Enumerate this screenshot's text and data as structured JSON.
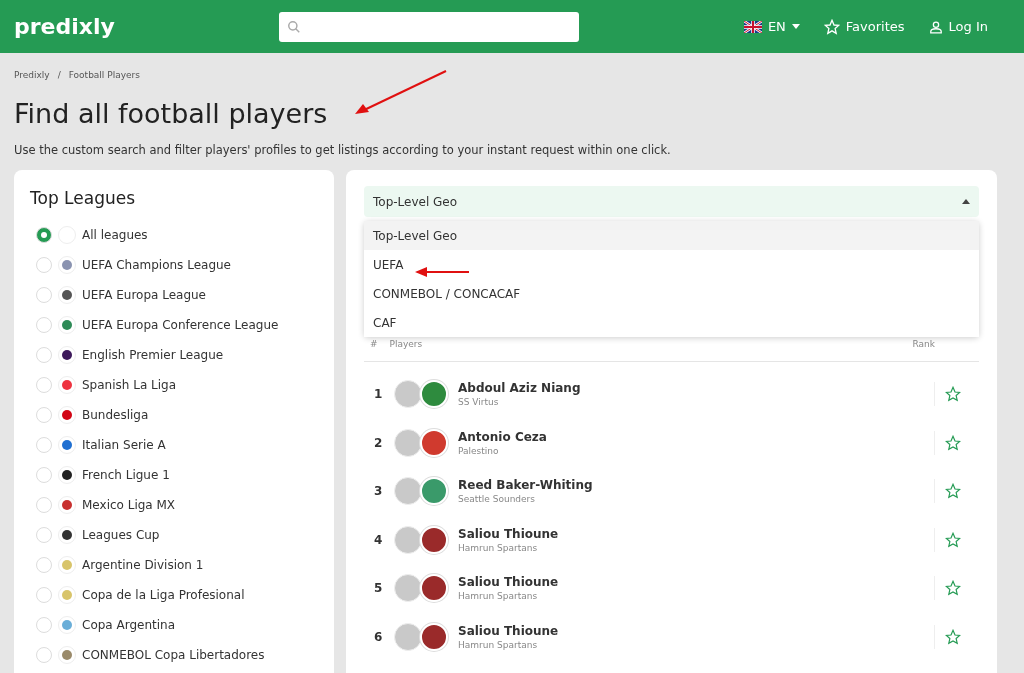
{
  "header": {
    "logo": "predixly",
    "language": "EN",
    "favorites": "Favorites",
    "login": "Log In"
  },
  "breadcrumb": {
    "separator": "/",
    "items": [
      "Predixly",
      "Football Players"
    ]
  },
  "title": "Find all football players",
  "description": "Use the custom search and filter players' profiles to get listings according to your instant request within one click.",
  "leagues": {
    "title": "Top Leagues",
    "items": [
      {
        "label": "All leagues",
        "selected": true,
        "color": "#ffffff"
      },
      {
        "label": "UEFA Champions League",
        "selected": false,
        "color": "#8a93b0"
      },
      {
        "label": "UEFA Europa League",
        "selected": false,
        "color": "#555555"
      },
      {
        "label": "UEFA Europa Conference League",
        "selected": false,
        "color": "#2e8b57"
      },
      {
        "label": "English Premier League",
        "selected": false,
        "color": "#3d195b"
      },
      {
        "label": "Spanish La Liga",
        "selected": false,
        "color": "#ee3340"
      },
      {
        "label": "Bundesliga",
        "selected": false,
        "color": "#d20515"
      },
      {
        "label": "Italian Serie A",
        "selected": false,
        "color": "#1f6fd1"
      },
      {
        "label": "French Ligue 1",
        "selected": false,
        "color": "#222222"
      },
      {
        "label": "Mexico Liga MX",
        "selected": false,
        "color": "#c8302f"
      },
      {
        "label": "Leagues Cup",
        "selected": false,
        "color": "#333333"
      },
      {
        "label": "Argentine Division 1",
        "selected": false,
        "color": "#d8c46a"
      },
      {
        "label": "Copa de la Liga Profesional",
        "selected": false,
        "color": "#d8c46a"
      },
      {
        "label": "Copa Argentina",
        "selected": false,
        "color": "#6aaed8"
      },
      {
        "label": "CONMEBOL Copa Libertadores",
        "selected": false,
        "color": "#9a8a6a"
      }
    ]
  },
  "geo": {
    "value": "Top-Level Geo",
    "expanded": true,
    "options": [
      {
        "label": "Top-Level Geo",
        "selected": true
      },
      {
        "label": "UEFA",
        "selected": false
      },
      {
        "label": "CONMEBOL / CONCACAF",
        "selected": false
      },
      {
        "label": "CAF",
        "selected": false
      }
    ]
  },
  "table": {
    "columns": [
      "#",
      "Players",
      "Rank"
    ],
    "rows": [
      {
        "rank": "1",
        "name": "Abdoul Aziz Niang",
        "club": "SS Virtus",
        "color": "#2e8b3e",
        "favorite": false
      },
      {
        "rank": "2",
        "name": "Antonio Ceza",
        "club": "Palestino",
        "color": "#d03a2e",
        "favorite": false
      },
      {
        "rank": "3",
        "name": "Reed Baker-Whiting",
        "club": "Seattle Sounders",
        "color": "#3a9a6a",
        "favorite": false
      },
      {
        "rank": "4",
        "name": "Saliou Thioune",
        "club": "Hamrun Spartans",
        "color": "#9a2a2a",
        "favorite": false
      },
      {
        "rank": "5",
        "name": "Saliou Thioune",
        "club": "Hamrun Spartans",
        "color": "#9a2a2a",
        "favorite": false
      },
      {
        "rank": "6",
        "name": "Saliou Thioune",
        "club": "Hamrun Spartans",
        "color": "#9a2a2a",
        "favorite": false
      }
    ]
  }
}
